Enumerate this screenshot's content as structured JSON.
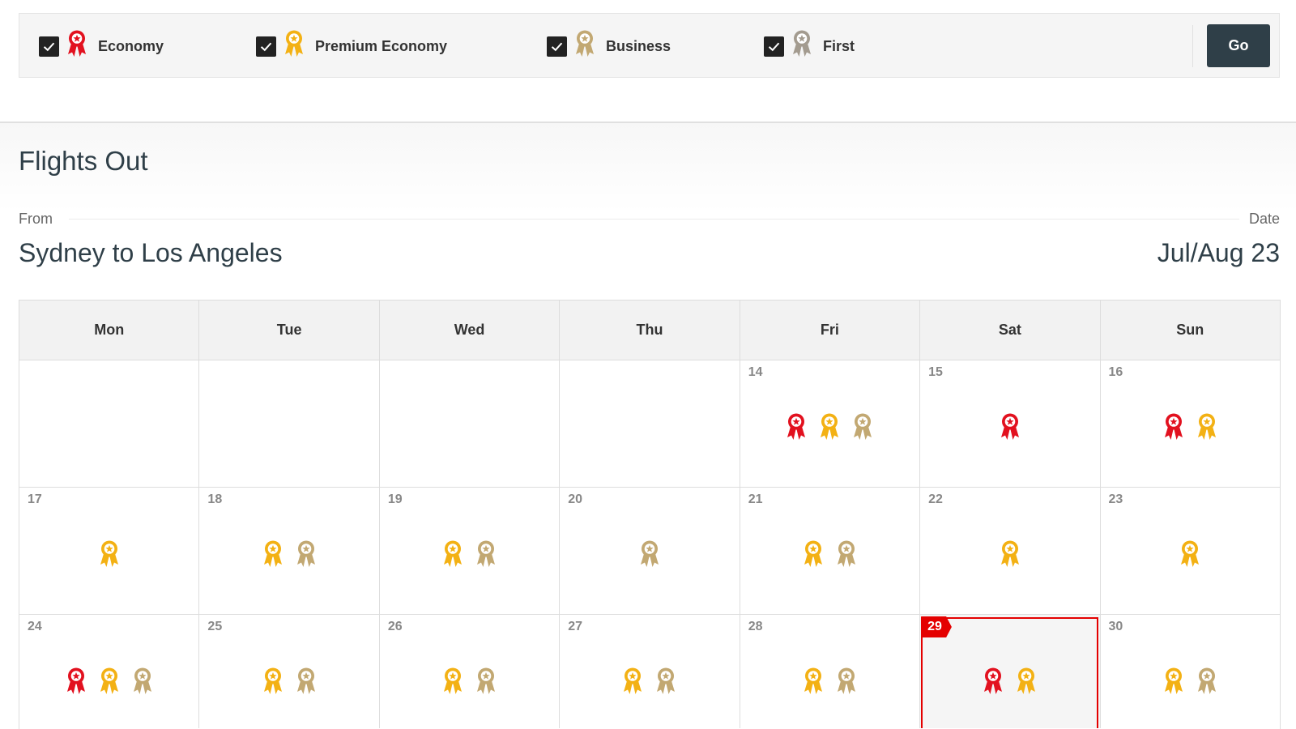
{
  "filters": {
    "items": [
      {
        "label": "Economy",
        "checked": true,
        "ribbon": "economy"
      },
      {
        "label": "Premium Economy",
        "checked": true,
        "ribbon": "premium"
      },
      {
        "label": "Business",
        "checked": true,
        "ribbon": "business"
      },
      {
        "label": "First",
        "checked": true,
        "ribbon": "first"
      }
    ],
    "go_label": "Go"
  },
  "section": {
    "title": "Flights Out",
    "from_label": "From",
    "date_label": "Date",
    "route": "Sydney to Los Angeles",
    "period": "Jul/Aug 23"
  },
  "calendar": {
    "weekdays": [
      "Mon",
      "Tue",
      "Wed",
      "Thu",
      "Fri",
      "Sat",
      "Sun"
    ],
    "selected_day": "29",
    "weeks": [
      [
        {
          "day": "",
          "avail": []
        },
        {
          "day": "",
          "avail": []
        },
        {
          "day": "",
          "avail": []
        },
        {
          "day": "",
          "avail": []
        },
        {
          "day": "14",
          "avail": [
            "economy",
            "premium",
            "business"
          ]
        },
        {
          "day": "15",
          "avail": [
            "economy"
          ]
        },
        {
          "day": "16",
          "avail": [
            "economy",
            "premium"
          ]
        }
      ],
      [
        {
          "day": "17",
          "avail": [
            "premium"
          ]
        },
        {
          "day": "18",
          "avail": [
            "premium",
            "business"
          ]
        },
        {
          "day": "19",
          "avail": [
            "premium",
            "business"
          ]
        },
        {
          "day": "20",
          "avail": [
            "business"
          ]
        },
        {
          "day": "21",
          "avail": [
            "premium",
            "business"
          ]
        },
        {
          "day": "22",
          "avail": [
            "premium"
          ]
        },
        {
          "day": "23",
          "avail": [
            "premium"
          ]
        }
      ],
      [
        {
          "day": "24",
          "avail": [
            "economy",
            "premium",
            "business"
          ]
        },
        {
          "day": "25",
          "avail": [
            "premium",
            "business"
          ]
        },
        {
          "day": "26",
          "avail": [
            "premium",
            "business"
          ]
        },
        {
          "day": "27",
          "avail": [
            "premium",
            "business"
          ]
        },
        {
          "day": "28",
          "avail": [
            "premium",
            "business"
          ]
        },
        {
          "day": "29",
          "avail": [
            "economy",
            "premium"
          ]
        },
        {
          "day": "30",
          "avail": [
            "premium",
            "business"
          ]
        }
      ]
    ]
  },
  "colors": {
    "economy": "#e2111f",
    "premium": "#f3b114",
    "business": "#c2a872",
    "first": "#a39b8f",
    "accent": "#e40000",
    "go_button": "#2f3f48"
  },
  "icons": {
    "economy": "economy-award-ribbon-icon",
    "premium": "premium-economy-award-ribbon-icon",
    "business": "business-award-ribbon-icon",
    "first": "first-award-ribbon-icon",
    "check": "checkmark-icon"
  }
}
